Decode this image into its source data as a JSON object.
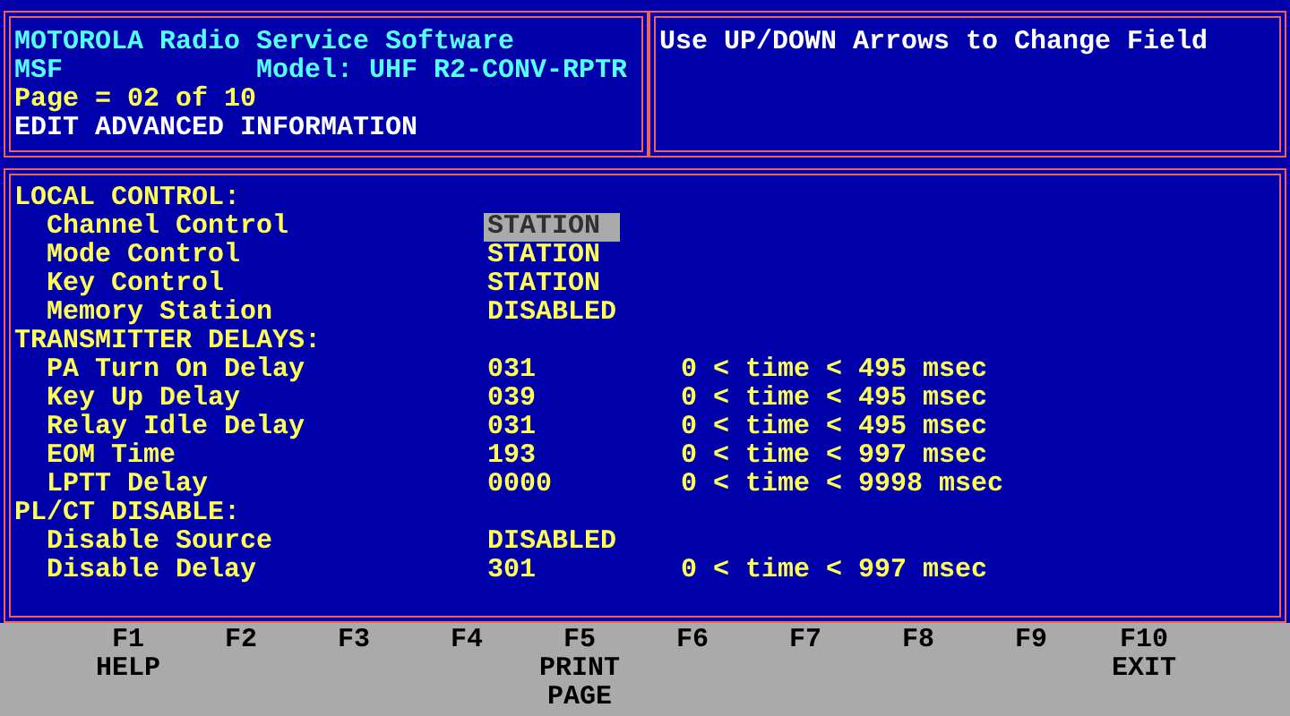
{
  "header": {
    "title": "MOTOROLA Radio Service Software",
    "program": "MSF",
    "model": "Model: UHF R2-CONV-RPTR",
    "page": "Page = 02 of 10",
    "screen": "EDIT ADVANCED INFORMATION"
  },
  "hint": "Use UP/DOWN Arrows to Change Field",
  "sections": [
    {
      "heading": "LOCAL CONTROL:",
      "fields": [
        {
          "label": "Channel Control",
          "value": "STATION",
          "selected": true
        },
        {
          "label": "Mode Control",
          "value": "STATION",
          "selected": false
        },
        {
          "label": "Key Control",
          "value": "STATION",
          "selected": false
        },
        {
          "label": "Memory Station",
          "value": "DISABLED",
          "selected": false
        }
      ]
    },
    {
      "heading": "TRANSMITTER DELAYS:",
      "fields": [
        {
          "label": "PA Turn On Delay",
          "value": "031",
          "range": "0 < time < 495 msec",
          "selected": false
        },
        {
          "label": "Key Up Delay",
          "value": "039",
          "range": "0 < time < 495 msec",
          "selected": false
        },
        {
          "label": "Relay Idle Delay",
          "value": "031",
          "range": "0 < time < 495 msec",
          "selected": false
        },
        {
          "label": "EOM Time",
          "value": "193",
          "range": "0 < time < 997 msec",
          "selected": false
        },
        {
          "label": "LPTT Delay",
          "value": "0000",
          "range": "0 < time < 9998 msec",
          "selected": false
        }
      ]
    },
    {
      "heading": "PL/CT DISABLE:",
      "fields": [
        {
          "label": "Disable Source",
          "value": "DISABLED",
          "selected": false
        },
        {
          "label": "Disable Delay",
          "value": "301",
          "range": "0 < time < 997 msec",
          "selected": false
        }
      ]
    }
  ],
  "function_keys": [
    {
      "key": "F1",
      "label": [
        "HELP"
      ]
    },
    {
      "key": "F2"
    },
    {
      "key": "F3"
    },
    {
      "key": "F4"
    },
    {
      "key": "F5",
      "label": [
        "PRINT",
        "PAGE"
      ]
    },
    {
      "key": "F6"
    },
    {
      "key": "F7"
    },
    {
      "key": "F8"
    },
    {
      "key": "F9"
    },
    {
      "key": "F10",
      "label": [
        "EXIT"
      ]
    }
  ]
}
